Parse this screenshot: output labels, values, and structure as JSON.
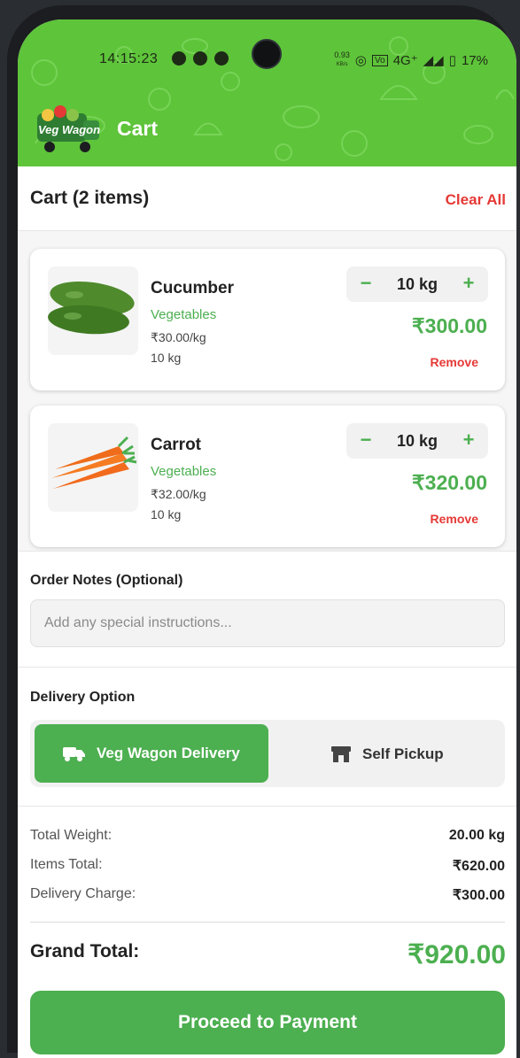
{
  "status_bar": {
    "time": "14:15:23",
    "network_speed": "0.93",
    "network_unit": "KB/s",
    "network": "4G⁺",
    "battery": "17%"
  },
  "header": {
    "logo_text": "Veg Wagon",
    "title": "Cart"
  },
  "cart": {
    "title": "Cart (2 items)",
    "clear_label": "Clear All"
  },
  "items": [
    {
      "name": "Cucumber",
      "category": "Vegetables",
      "unit_price": "₹30.00/kg",
      "quantity_text": "10 kg",
      "qty": "10 kg",
      "line_total": "₹300.00",
      "remove_label": "Remove",
      "minus": "−",
      "plus": "+"
    },
    {
      "name": "Carrot",
      "category": "Vegetables",
      "unit_price": "₹32.00/kg",
      "quantity_text": "10 kg",
      "qty": "10 kg",
      "line_total": "₹320.00",
      "remove_label": "Remove",
      "minus": "−",
      "plus": "+"
    }
  ],
  "notes": {
    "label": "Order Notes (Optional)",
    "placeholder": "Add any special instructions..."
  },
  "delivery": {
    "label": "Delivery Option",
    "options": [
      {
        "label": "Veg Wagon Delivery",
        "icon": "truck-icon",
        "selected": true
      },
      {
        "label": "Self Pickup",
        "icon": "store-icon",
        "selected": false
      }
    ]
  },
  "summary": {
    "total_weight_label": "Total Weight:",
    "total_weight": "20.00 kg",
    "items_total_label": "Items Total:",
    "items_total": "₹620.00",
    "delivery_label": "Delivery Charge:",
    "delivery_charge": "₹300.00",
    "grand_label": "Grand Total:",
    "grand_total": "₹920.00"
  },
  "cta": {
    "label": "Proceed to Payment"
  },
  "colors": {
    "primary": "#4caf50",
    "header": "#5ec43a",
    "danger": "#e53935"
  }
}
